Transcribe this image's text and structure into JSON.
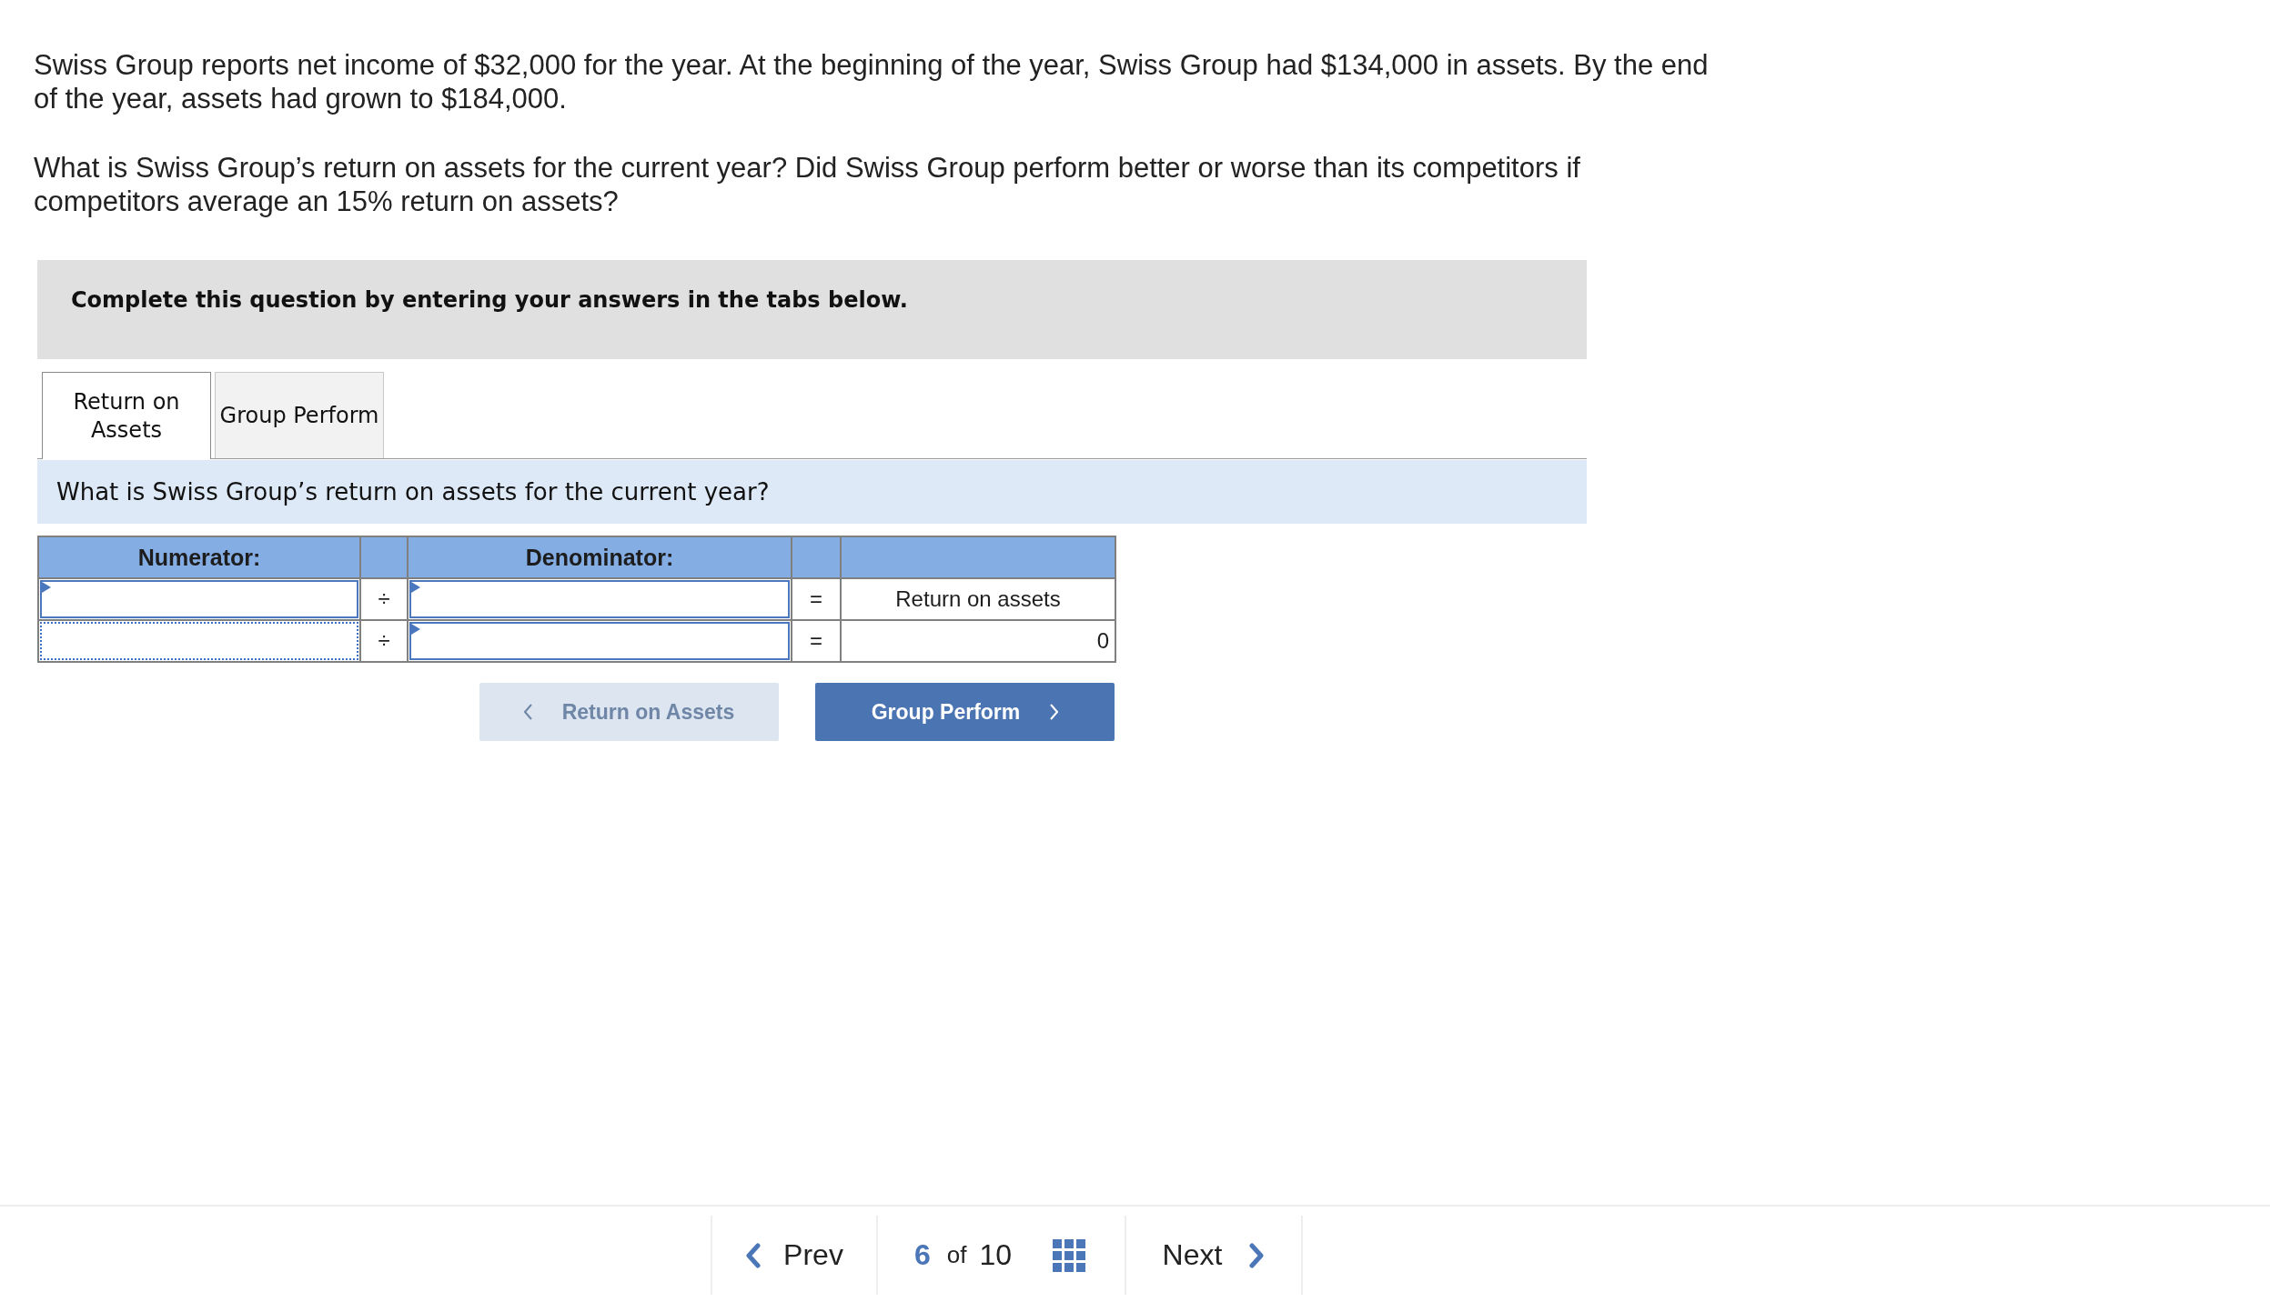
{
  "question": {
    "paragraphs": [
      "Swiss Group reports net income of $32,000 for the year. At the beginning of the year, Swiss Group had $134,000 in assets. By the end of the year, assets had grown to $184,000.",
      "What is Swiss Group’s return on assets for the current year? Did Swiss Group perform better or worse than its competitors if competitors average an 15% return on assets?"
    ]
  },
  "instruction": "Complete this question by entering your answers in the tabs below.",
  "tabs": [
    {
      "label": "Return on Assets",
      "selected": true
    },
    {
      "label": "Group Perform",
      "selected": false
    }
  ],
  "tab_prompt": "What is Swiss Group’s return on assets for the current year?",
  "table": {
    "headers": {
      "numerator": "Numerator:",
      "denominator": "Denominator:"
    },
    "rows": [
      {
        "numerator": {
          "focused": false
        },
        "operator": "÷",
        "denominator": {
          "focused": false
        },
        "equals": "=",
        "result": {
          "kind": "label",
          "text": "Return on assets"
        }
      },
      {
        "numerator": {
          "focused": true
        },
        "operator": "÷",
        "denominator": {
          "focused": false
        },
        "equals": "=",
        "result": {
          "kind": "value",
          "text": "0"
        }
      }
    ]
  },
  "nav_buttons": [
    {
      "kind": "back",
      "label": "Return on Assets",
      "disabled": true
    },
    {
      "kind": "forward",
      "label": "Group Perform",
      "disabled": false
    }
  ],
  "footer": {
    "prev": "Prev",
    "current": "6",
    "of": "of",
    "total": "10",
    "next": "Next"
  }
}
